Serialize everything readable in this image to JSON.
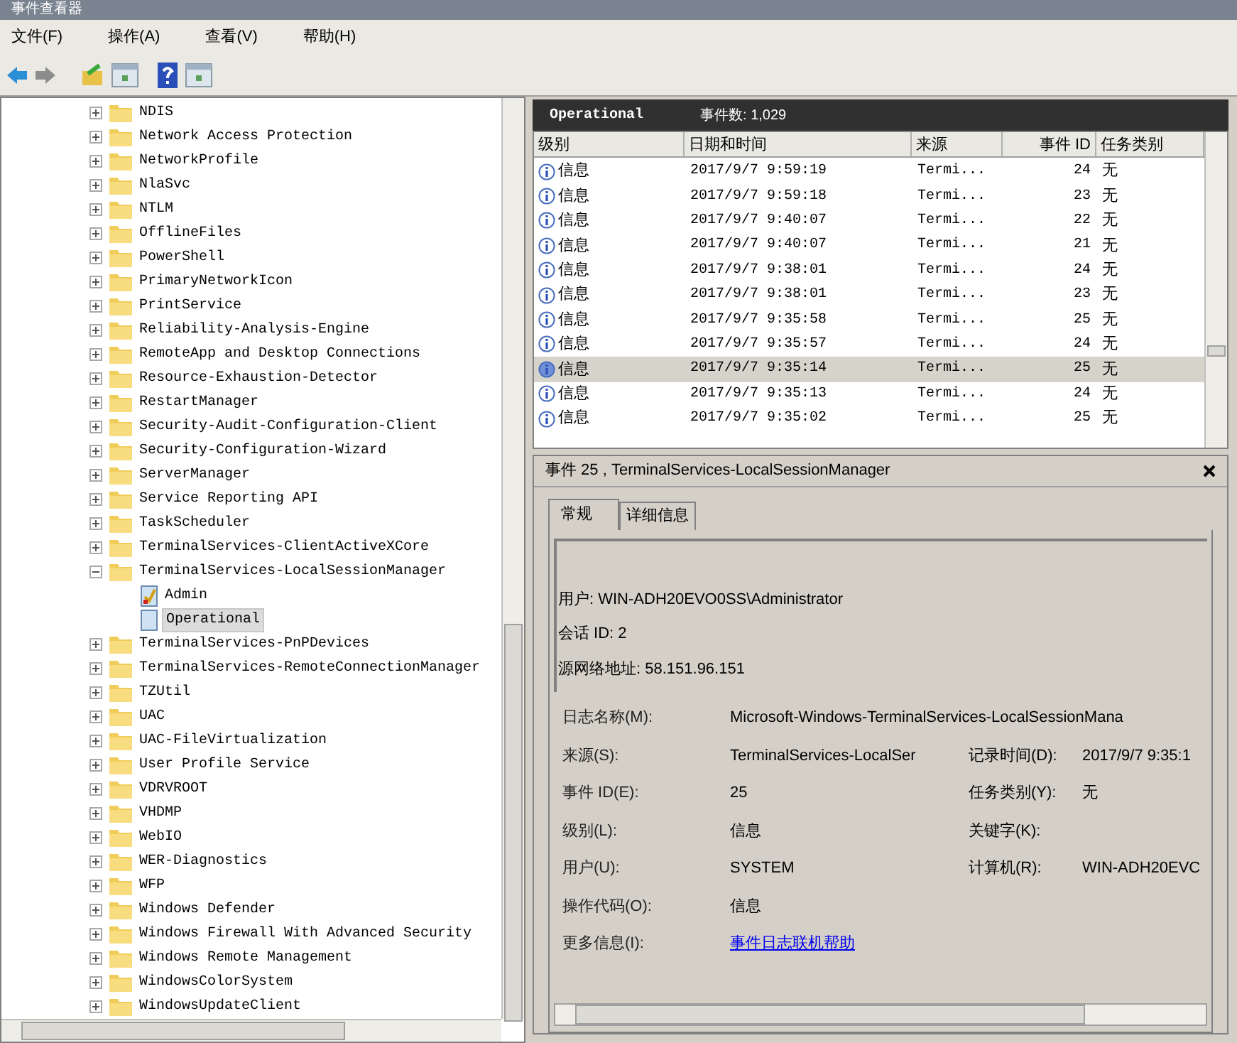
{
  "window": {
    "title": "事件查看器"
  },
  "menu": [
    "文件(F)",
    "操作(A)",
    "查看(V)",
    "帮助(H)"
  ],
  "tree": [
    {
      "label": "NDIS",
      "expanded": false
    },
    {
      "label": "Network Access Protection",
      "expanded": false
    },
    {
      "label": "NetworkProfile",
      "expanded": false
    },
    {
      "label": "NlaSvc",
      "expanded": false
    },
    {
      "label": "NTLM",
      "expanded": false
    },
    {
      "label": "OfflineFiles",
      "expanded": false
    },
    {
      "label": "PowerShell",
      "expanded": false
    },
    {
      "label": "PrimaryNetworkIcon",
      "expanded": false
    },
    {
      "label": "PrintService",
      "expanded": false
    },
    {
      "label": "Reliability-Analysis-Engine",
      "expanded": false
    },
    {
      "label": "RemoteApp and Desktop Connections",
      "expanded": false
    },
    {
      "label": "Resource-Exhaustion-Detector",
      "expanded": false
    },
    {
      "label": "RestartManager",
      "expanded": false
    },
    {
      "label": "Security-Audit-Configuration-Client",
      "expanded": false
    },
    {
      "label": "Security-Configuration-Wizard",
      "expanded": false
    },
    {
      "label": "ServerManager",
      "expanded": false
    },
    {
      "label": "Service Reporting API",
      "expanded": false
    },
    {
      "label": "TaskScheduler",
      "expanded": false
    },
    {
      "label": "TerminalServices-ClientActiveXCore",
      "expanded": false
    },
    {
      "label": "TerminalServices-LocalSessionManager",
      "expanded": true,
      "children": [
        {
          "label": "Admin",
          "kind": "admin-log",
          "selected": false
        },
        {
          "label": "Operational",
          "kind": "log",
          "selected": true
        }
      ]
    },
    {
      "label": "TerminalServices-PnPDevices",
      "expanded": false
    },
    {
      "label": "TerminalServices-RemoteConnectionManager",
      "expanded": false
    },
    {
      "label": "TZUtil",
      "expanded": false
    },
    {
      "label": "UAC",
      "expanded": false
    },
    {
      "label": "UAC-FileVirtualization",
      "expanded": false
    },
    {
      "label": "User Profile Service",
      "expanded": false
    },
    {
      "label": "VDRVROOT",
      "expanded": false
    },
    {
      "label": "VHDMP",
      "expanded": false
    },
    {
      "label": "WebIO",
      "expanded": false
    },
    {
      "label": "WER-Diagnostics",
      "expanded": false
    },
    {
      "label": "WFP",
      "expanded": false
    },
    {
      "label": "Windows Defender",
      "expanded": false
    },
    {
      "label": "Windows Firewall With Advanced Security",
      "expanded": false
    },
    {
      "label": "Windows Remote Management",
      "expanded": false
    },
    {
      "label": "WindowsColorSystem",
      "expanded": false
    },
    {
      "label": "WindowsUpdateClient",
      "expanded": false
    }
  ],
  "log_header": {
    "name": "Operational",
    "count": "事件数: 1,029"
  },
  "table": {
    "columns": [
      "级别",
      "日期和时间",
      "来源",
      "事件 ID",
      "任务类别"
    ],
    "rows": [
      {
        "level": "信息",
        "date": "2017/9/7 9:59:19",
        "source": "Termi...",
        "id": "24",
        "category": "无",
        "selected": false
      },
      {
        "level": "信息",
        "date": "2017/9/7 9:59:18",
        "source": "Termi...",
        "id": "23",
        "category": "无",
        "selected": false
      },
      {
        "level": "信息",
        "date": "2017/9/7 9:40:07",
        "source": "Termi...",
        "id": "22",
        "category": "无",
        "selected": false
      },
      {
        "level": "信息",
        "date": "2017/9/7 9:40:07",
        "source": "Termi...",
        "id": "21",
        "category": "无",
        "selected": false
      },
      {
        "level": "信息",
        "date": "2017/9/7 9:38:01",
        "source": "Termi...",
        "id": "24",
        "category": "无",
        "selected": false
      },
      {
        "level": "信息",
        "date": "2017/9/7 9:38:01",
        "source": "Termi...",
        "id": "23",
        "category": "无",
        "selected": false
      },
      {
        "level": "信息",
        "date": "2017/9/7 9:35:58",
        "source": "Termi...",
        "id": "25",
        "category": "无",
        "selected": false
      },
      {
        "level": "信息",
        "date": "2017/9/7 9:35:57",
        "source": "Termi...",
        "id": "24",
        "category": "无",
        "selected": false
      },
      {
        "level": "信息",
        "date": "2017/9/7 9:35:14",
        "source": "Termi...",
        "id": "25",
        "category": "无",
        "selected": true
      },
      {
        "level": "信息",
        "date": "2017/9/7 9:35:13",
        "source": "Termi...",
        "id": "24",
        "category": "无",
        "selected": false
      },
      {
        "level": "信息",
        "date": "2017/9/7 9:35:02",
        "source": "Termi...",
        "id": "25",
        "category": "无",
        "selected": false
      }
    ]
  },
  "detail": {
    "title": "事件 25 , TerminalServices-LocalSessionManager",
    "tabs": [
      {
        "label": "常规",
        "selected": true
      },
      {
        "label": "详细信息",
        "selected": false
      }
    ],
    "description": [
      "用户: WIN-ADH20EVO0SS\\Administrator",
      "会话 ID: 2",
      "源网络地址: 58.151.96.151"
    ],
    "fields": [
      {
        "label": "日志名称(M):",
        "value": "Microsoft-Windows-TerminalServices-LocalSessionMana"
      },
      {
        "label": "来源(S):",
        "value": "TerminalServices-LocalSer",
        "label2": "记录时间(D):",
        "value2": "2017/9/7 9:35:1"
      },
      {
        "label": "事件 ID(E):",
        "value": "25",
        "label2": "任务类别(Y):",
        "value2": "无"
      },
      {
        "label": "级别(L):",
        "value": "信息",
        "label2": "关键字(K):"
      },
      {
        "label": "用户(U):",
        "value": "SYSTEM",
        "label2": "计算机(R):",
        "value2": "WIN-ADH20EVC"
      },
      {
        "label": "操作代码(O):",
        "value": "信息"
      },
      {
        "label": "更多信息(I):",
        "link": "事件日志联机帮助"
      }
    ]
  }
}
